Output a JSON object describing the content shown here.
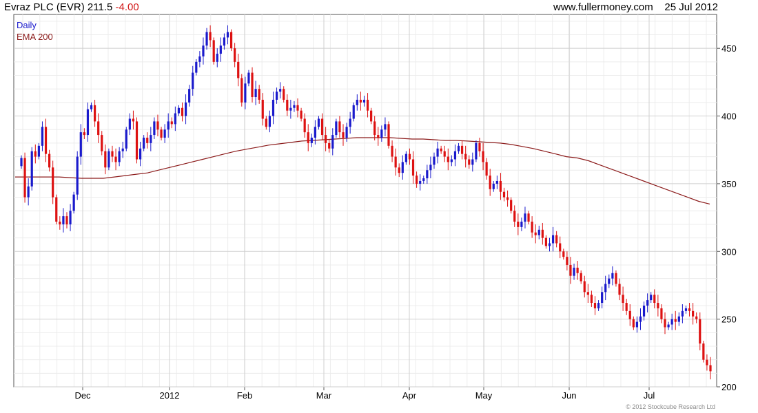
{
  "header": {
    "name": "Evraz PLC (EVR)",
    "price": "211.5",
    "change": "-4.00",
    "site": "www.fullermoney.com",
    "date": "25 Jul 2012"
  },
  "legend": {
    "daily": "Daily",
    "ema": "EMA 200"
  },
  "copyright": "© 2012 Stockcube Research Ltd",
  "colors": {
    "up": "#1a1acc",
    "down": "#dd1111",
    "ema": "#8b1a1a",
    "grid": "#cfcfcf",
    "frame": "#555555"
  },
  "chart_data": {
    "type": "candlestick",
    "title": "Evraz PLC (EVR) 211.5 -4.00",
    "ylim": [
      200,
      475
    ],
    "y_ticks": [
      200,
      250,
      300,
      350,
      400,
      450
    ],
    "x_ticks": [
      "Dec",
      "2012",
      "Feb",
      "Mar",
      "Apr",
      "May",
      "Jun",
      "Jul"
    ],
    "grid": true,
    "legend_position": "top-left",
    "series": [
      {
        "name": "Daily",
        "type": "candlestick"
      },
      {
        "name": "EMA 200",
        "type": "line"
      }
    ],
    "closes": [
      369,
      340,
      348,
      374,
      370,
      378,
      392,
      372,
      362,
      340,
      322,
      320,
      326,
      320,
      330,
      342,
      370,
      388,
      386,
      405,
      408,
      396,
      386,
      374,
      362,
      374,
      370,
      366,
      374,
      376,
      390,
      398,
      396,
      368,
      376,
      384,
      380,
      386,
      396,
      390,
      384,
      390,
      396,
      394,
      402,
      406,
      400,
      410,
      420,
      432,
      440,
      444,
      452,
      462,
      456,
      440,
      446,
      452,
      458,
      462,
      450,
      440,
      428,
      410,
      424,
      432,
      414,
      420,
      412,
      398,
      392,
      400,
      412,
      418,
      420,
      412,
      404,
      406,
      408,
      404,
      398,
      388,
      380,
      384,
      392,
      398,
      386,
      380,
      376,
      386,
      396,
      388,
      384,
      392,
      398,
      408,
      412,
      410,
      412,
      404,
      396,
      386,
      384,
      390,
      394,
      378,
      370,
      362,
      358,
      366,
      372,
      368,
      356,
      350,
      352,
      354,
      360,
      364,
      370,
      376,
      374,
      370,
      366,
      368,
      374,
      378,
      372,
      368,
      364,
      368,
      380,
      374,
      366,
      356,
      346,
      350,
      352,
      344,
      340,
      338,
      330,
      322,
      318,
      322,
      328,
      322,
      314,
      312,
      316,
      310,
      304,
      306,
      312,
      306,
      300,
      296,
      290,
      282,
      288,
      284,
      278,
      270,
      268,
      262,
      258,
      262,
      270,
      276,
      280,
      284,
      276,
      268,
      262,
      256,
      250,
      244,
      248,
      252,
      260,
      264,
      268,
      262,
      258,
      250,
      244,
      246,
      250,
      248,
      252,
      256,
      258,
      256,
      252,
      250,
      232,
      220,
      216,
      211.5
    ],
    "ema200": [
      355,
      355,
      355,
      355,
      355,
      354.5,
      354,
      354,
      354,
      355,
      356,
      357,
      358,
      360,
      362,
      364,
      366,
      368,
      370,
      372,
      374,
      375.5,
      377,
      378.5,
      379.5,
      380.5,
      381.5,
      382,
      382.5,
      383,
      383.5,
      384,
      384,
      384,
      384,
      383.5,
      383,
      383,
      382.5,
      382,
      382,
      381.5,
      381,
      380.5,
      380,
      379,
      377.5,
      376,
      374,
      372,
      370,
      369,
      367,
      364,
      361,
      358,
      355,
      352,
      349,
      346,
      343,
      340,
      337,
      335
    ]
  }
}
